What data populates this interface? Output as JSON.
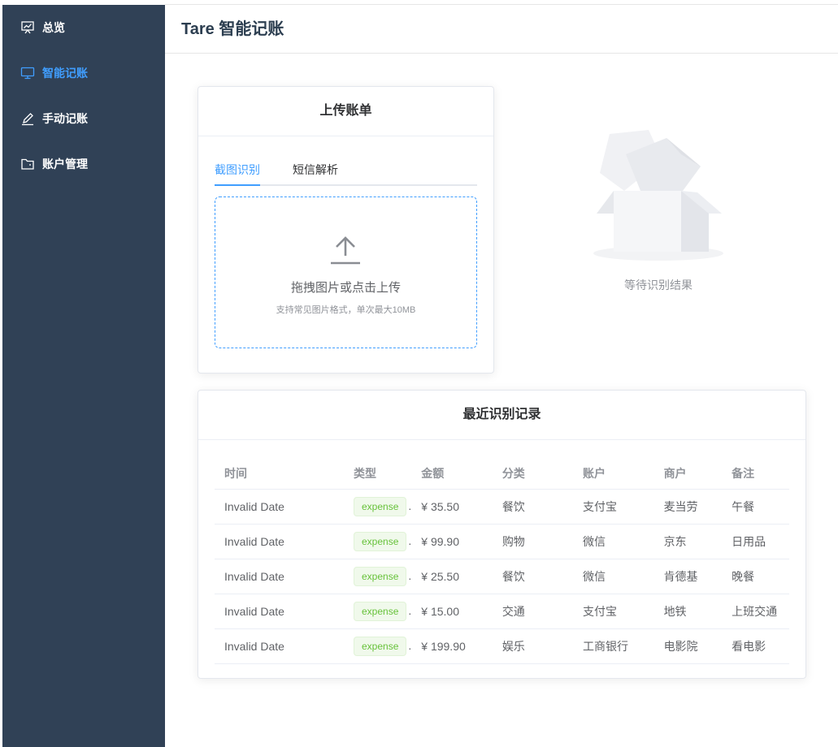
{
  "sidebar": {
    "items": [
      {
        "label": "总览",
        "icon": "presentation-chart-icon",
        "active": false
      },
      {
        "label": "智能记账",
        "icon": "monitor-icon",
        "active": true
      },
      {
        "label": "手动记账",
        "icon": "pen-icon",
        "active": false
      },
      {
        "label": "账户管理",
        "icon": "folder-icon",
        "active": false
      }
    ]
  },
  "header": {
    "title": "Tare 智能记账"
  },
  "upload": {
    "title": "上传账单",
    "tabs": [
      {
        "label": "截图识别",
        "active": true
      },
      {
        "label": "短信解析",
        "active": false
      }
    ],
    "dropzone_text": "拖拽图片或点击上传",
    "dropzone_tip": "支持常见图片格式，单次最大10MB",
    "icon": "upload-icon"
  },
  "result": {
    "empty_text": "等待识别结果",
    "icon": "empty-box-icon"
  },
  "records": {
    "title": "最近识别记录",
    "columns": [
      "时间",
      "类型",
      "金额",
      "分类",
      "账户",
      "商户",
      "备注"
    ],
    "rows": [
      {
        "time": "Invalid Date",
        "type": "expense",
        "amount": "¥ 35.50",
        "category": "餐饮",
        "account": "支付宝",
        "merchant": "麦当劳",
        "note": "午餐"
      },
      {
        "time": "Invalid Date",
        "type": "expense",
        "amount": "¥ 99.90",
        "category": "购物",
        "account": "微信",
        "merchant": "京东",
        "note": "日用品"
      },
      {
        "time": "Invalid Date",
        "type": "expense",
        "amount": "¥ 25.50",
        "category": "餐饮",
        "account": "微信",
        "merchant": "肯德基",
        "note": "晚餐"
      },
      {
        "time": "Invalid Date",
        "type": "expense",
        "amount": "¥ 15.00",
        "category": "交通",
        "account": "支付宝",
        "merchant": "地铁",
        "note": "上班交通"
      },
      {
        "time": "Invalid Date",
        "type": "expense",
        "amount": "¥ 199.90",
        "category": "娱乐",
        "account": "工商银行",
        "merchant": "电影院",
        "note": "看电影"
      }
    ]
  },
  "colors": {
    "sidebar_bg": "#304156",
    "accent": "#409eff",
    "tag_green": "#67c23a"
  }
}
